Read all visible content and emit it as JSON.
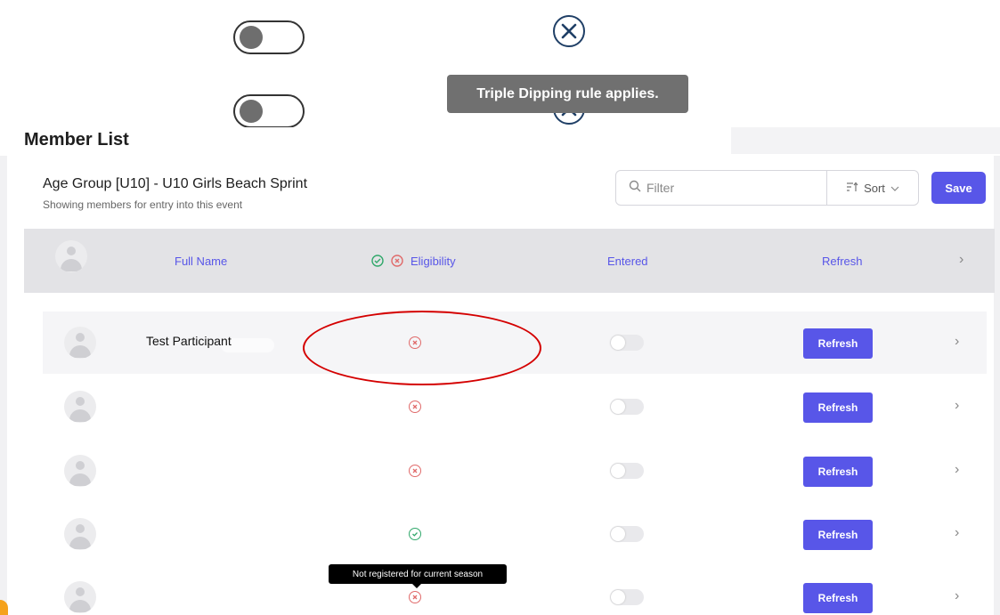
{
  "overlay": {
    "tooltip_text": "Triple Dipping rule applies."
  },
  "member_list": {
    "title": "Member List"
  },
  "card": {
    "title": "Age Group [U10] - U10 Girls Beach Sprint",
    "subtitle": "Showing members for entry into this event",
    "filter_placeholder": "Filter",
    "sort_label": "Sort",
    "save_label": "Save"
  },
  "table": {
    "headers": {
      "full_name": "Full Name",
      "eligibility": "Eligibility",
      "entered": "Entered",
      "refresh": "Refresh"
    },
    "rows": [
      {
        "name": "Test Participant",
        "eligibility": "not-eligible",
        "entered": false,
        "refresh_label": "Refresh"
      },
      {
        "name": "",
        "eligibility": "not-eligible",
        "entered": false,
        "refresh_label": "Refresh"
      },
      {
        "name": "",
        "eligibility": "not-eligible",
        "entered": false,
        "refresh_label": "Refresh"
      },
      {
        "name": "",
        "eligibility": "eligible",
        "entered": false,
        "refresh_label": "Refresh"
      },
      {
        "name": "",
        "eligibility": "not-eligible",
        "entered": false,
        "refresh_label": "Refresh"
      }
    ],
    "row_tooltip": "Not registered for current season"
  },
  "colors": {
    "accent": "#5856e8",
    "error": "#e06a6a",
    "success": "#31a86b",
    "annotation": "#d40000"
  },
  "icons": {
    "toggle": "toggle-off-icon",
    "close": "close-circle-icon",
    "search": "search-icon",
    "sort": "sort-icon",
    "chevron": "chevron-right-icon",
    "avatar": "avatar-icon",
    "check": "check-circle-icon",
    "cross": "x-circle-icon"
  }
}
